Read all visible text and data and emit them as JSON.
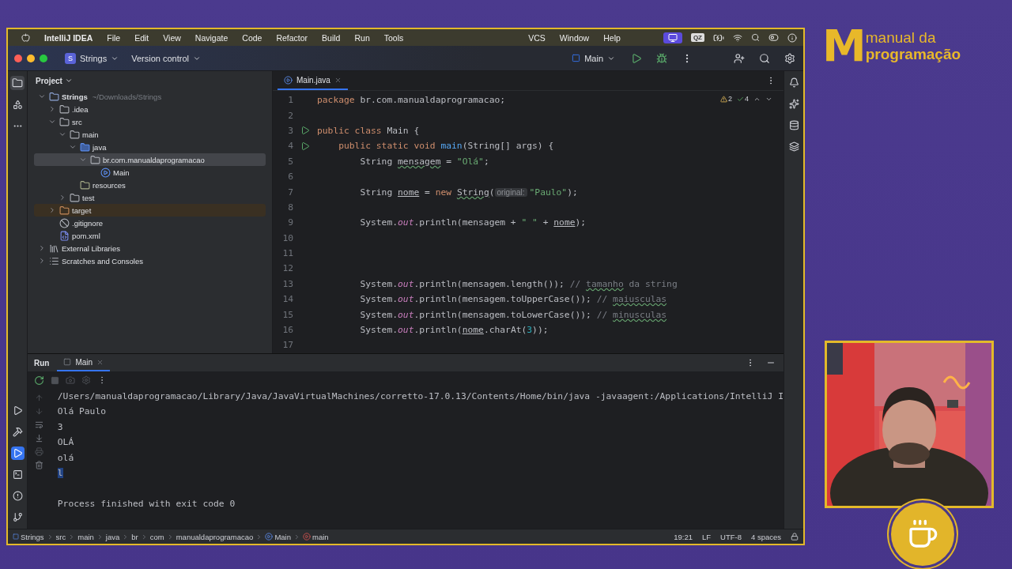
{
  "menu_bar": {
    "app": "IntelliJ IDEA",
    "items": [
      "File",
      "Edit",
      "View",
      "Navigate",
      "Code",
      "Refactor",
      "Build",
      "Run",
      "Tools"
    ],
    "items_after_notch": [
      "VCS",
      "Window",
      "Help"
    ],
    "badge": "QZ"
  },
  "title_bar": {
    "project_initial": "S",
    "project": "Strings",
    "vcs": "Version control",
    "run_config": "Main"
  },
  "project_panel": {
    "title": "Project",
    "tree": [
      {
        "label": "Strings",
        "kind": "project",
        "path": "~/Downloads/Strings",
        "expanded": true,
        "selected": false,
        "children": [
          {
            "label": ".idea",
            "kind": "folder",
            "expanded": false,
            "selected": false
          },
          {
            "label": "src",
            "kind": "folder",
            "expanded": true,
            "selected": false,
            "children": [
              {
                "label": "main",
                "kind": "folder",
                "expanded": true,
                "selected": false,
                "children": [
                  {
                    "label": "java",
                    "kind": "source",
                    "expanded": true,
                    "selected": false,
                    "children": [
                      {
                        "label": "br.com.manualdaprogramacao",
                        "kind": "package",
                        "expanded": true,
                        "selected": true,
                        "children": [
                          {
                            "label": "Main",
                            "kind": "class",
                            "selected": false
                          }
                        ]
                      }
                    ]
                  },
                  {
                    "label": "resources",
                    "kind": "resources",
                    "selected": false
                  }
                ]
              },
              {
                "label": "test",
                "kind": "folder",
                "expanded": false,
                "selected": false
              }
            ]
          },
          {
            "label": "target",
            "kind": "excluded",
            "expanded": false,
            "selected": false
          },
          {
            "label": ".gitignore",
            "kind": "ignore",
            "selected": false
          },
          {
            "label": "pom.xml",
            "kind": "maven",
            "selected": false
          }
        ]
      },
      {
        "label": "External Libraries",
        "kind": "libraries",
        "expanded": false,
        "selected": false
      },
      {
        "label": "Scratches and Consoles",
        "kind": "scratches",
        "expanded": false,
        "selected": false
      }
    ]
  },
  "editor": {
    "tabs": [
      {
        "label": "Main.java",
        "selected": true
      }
    ],
    "warnings": "2",
    "checks": "4",
    "lines": [
      {
        "number": "1",
        "run": false,
        "tokens": [
          {
            "kind": "kw",
            "text": "package "
          },
          {
            "kind": "plain",
            "text": "br.com.manualdaprogramacao;"
          }
        ]
      },
      {
        "number": "2",
        "run": false
      },
      {
        "number": "3",
        "run": true,
        "tokens": [
          {
            "kind": "kw",
            "text": "public class "
          },
          {
            "kind": "plain",
            "text": "Main {"
          }
        ]
      },
      {
        "number": "4",
        "run": true,
        "tokens": [
          {
            "kind": "kw",
            "text": "    public static void "
          },
          {
            "kind": "method",
            "text": "main"
          },
          {
            "kind": "plain",
            "text": "(String[] args) {"
          }
        ]
      },
      {
        "number": "5",
        "run": false,
        "tokens": [
          {
            "kind": "plain",
            "text": "        String "
          },
          {
            "kind": "typo",
            "text": "mensagem"
          },
          {
            "kind": "plain",
            "text": " = "
          },
          {
            "kind": "str",
            "text": "\"Olá\""
          },
          {
            "kind": "plain",
            "text": ";"
          }
        ]
      },
      {
        "number": "6",
        "run": false
      },
      {
        "number": "7",
        "run": false,
        "tokens": [
          {
            "kind": "plain",
            "text": "        String "
          },
          {
            "kind": "ref",
            "text": "nome"
          },
          {
            "kind": "plain",
            "text": " = "
          },
          {
            "kind": "kw",
            "text": "new "
          },
          {
            "kind": "typo",
            "text": "String"
          },
          {
            "kind": "plain",
            "text": "("
          },
          {
            "kind": "hint",
            "text": "original:"
          },
          {
            "kind": "str",
            "text": "\"Paulo\""
          },
          {
            "kind": "plain",
            "text": ");"
          }
        ]
      },
      {
        "number": "8",
        "run": false
      },
      {
        "number": "9",
        "run": false,
        "tokens": [
          {
            "kind": "plain",
            "text": "        System."
          },
          {
            "kind": "field",
            "text": "out"
          },
          {
            "kind": "plain",
            "text": ".println(mensagem + "
          },
          {
            "kind": "str",
            "text": "\" \""
          },
          {
            "kind": "plain",
            "text": " + "
          },
          {
            "kind": "ref",
            "text": "nome"
          },
          {
            "kind": "plain",
            "text": ");"
          }
        ]
      },
      {
        "number": "10",
        "run": false
      },
      {
        "number": "11",
        "run": false
      },
      {
        "number": "12",
        "run": false
      },
      {
        "number": "13",
        "run": false,
        "tokens": [
          {
            "kind": "plain",
            "text": "        System."
          },
          {
            "kind": "field",
            "text": "out"
          },
          {
            "kind": "plain",
            "text": ".println(mensagem.length()); "
          },
          {
            "kind": "comment",
            "text": "// "
          },
          {
            "kind": "comment_typo",
            "text": "tamanho"
          },
          {
            "kind": "comment",
            "text": " da string"
          }
        ]
      },
      {
        "number": "14",
        "run": false,
        "tokens": [
          {
            "kind": "plain",
            "text": "        System."
          },
          {
            "kind": "field",
            "text": "out"
          },
          {
            "kind": "plain",
            "text": ".println(mensagem.toUpperCase()); "
          },
          {
            "kind": "comment",
            "text": "// "
          },
          {
            "kind": "comment_typo",
            "text": "maiusculas"
          }
        ]
      },
      {
        "number": "15",
        "run": false,
        "tokens": [
          {
            "kind": "plain",
            "text": "        System."
          },
          {
            "kind": "field",
            "text": "out"
          },
          {
            "kind": "plain",
            "text": ".println(mensagem.toLowerCase()); "
          },
          {
            "kind": "comment",
            "text": "// "
          },
          {
            "kind": "comment_typo",
            "text": "minusculas"
          }
        ]
      },
      {
        "number": "16",
        "run": false,
        "tokens": [
          {
            "kind": "plain",
            "text": "        System."
          },
          {
            "kind": "field",
            "text": "out"
          },
          {
            "kind": "plain",
            "text": ".println("
          },
          {
            "kind": "ref",
            "text": "nome"
          },
          {
            "kind": "plain",
            "text": ".charAt("
          },
          {
            "kind": "num",
            "text": "3"
          },
          {
            "kind": "plain",
            "text": "));"
          }
        ]
      },
      {
        "number": "17",
        "run": false
      }
    ]
  },
  "run_panel": {
    "title": "Run",
    "tabs": [
      {
        "label": "Main",
        "selected": true
      }
    ],
    "console": [
      {
        "kind": "command",
        "text": "/Users/manualdaprogramacao/Library/Java/JavaVirtualMachines/corretto-17.0.13/Contents/Home/bin/java -javaagent:/Applications/IntelliJ I",
        "selected": false
      },
      {
        "kind": "output",
        "text": "Olá Paulo",
        "selected": false
      },
      {
        "kind": "output",
        "text": "3",
        "selected": false
      },
      {
        "kind": "output",
        "text": "OLÁ",
        "selected": false
      },
      {
        "kind": "output",
        "text": "olá",
        "selected": false
      },
      {
        "kind": "output",
        "text": "l",
        "selected": true
      },
      {
        "kind": "status",
        "text": "Process finished with exit code 0",
        "selected": false
      }
    ]
  },
  "status_bar": {
    "crumbs": [
      {
        "label": "Strings",
        "kind": "module"
      },
      {
        "label": "src",
        "kind": "plain"
      },
      {
        "label": "main",
        "kind": "plain"
      },
      {
        "label": "java",
        "kind": "plain"
      },
      {
        "label": "br",
        "kind": "plain"
      },
      {
        "label": "com",
        "kind": "plain"
      },
      {
        "label": "manualdaprogramacao",
        "kind": "plain"
      },
      {
        "label": "Main",
        "kind": "class"
      },
      {
        "label": "main",
        "kind": "method"
      }
    ],
    "position": "19:21",
    "line_ending": "LF",
    "encoding": "UTF-8",
    "indent": "4 spaces"
  },
  "branding": {
    "mark": "M",
    "line1": "manual da",
    "line2": "programação"
  }
}
